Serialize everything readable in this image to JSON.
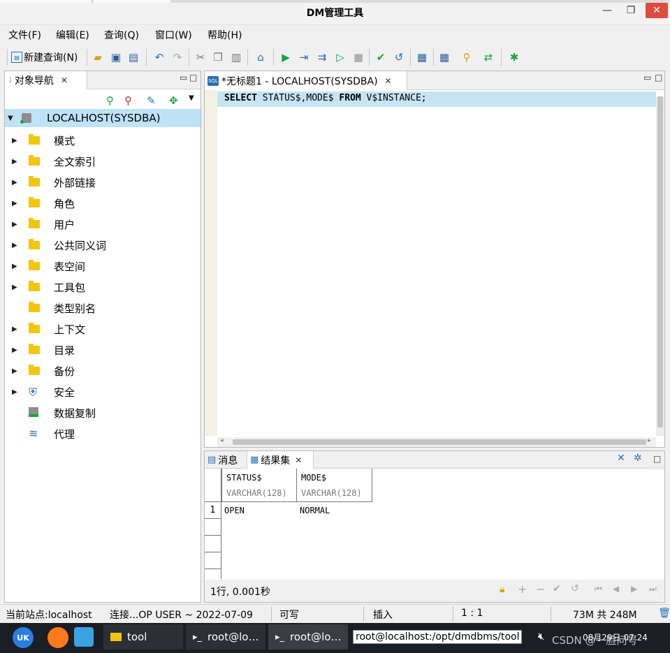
{
  "window": {
    "title": "DM管理工具"
  },
  "menu": [
    "文件(F)",
    "编辑(E)",
    "查询(Q)",
    "窗口(W)",
    "帮助(H)"
  ],
  "toolbar": {
    "new_query": "新建查询(N)"
  },
  "navigator": {
    "tab_label": "对象导航",
    "root": "LOCALHOST(SYSDBA)",
    "items": [
      {
        "label": "模式",
        "expandable": true,
        "icon": "folder-icon"
      },
      {
        "label": "全文索引",
        "expandable": true,
        "icon": "folder-icon"
      },
      {
        "label": "外部链接",
        "expandable": true,
        "icon": "folder-icon"
      },
      {
        "label": "角色",
        "expandable": true,
        "icon": "folder-icon"
      },
      {
        "label": "用户",
        "expandable": true,
        "icon": "folder-icon"
      },
      {
        "label": "公共同义词",
        "expandable": true,
        "icon": "folder-icon"
      },
      {
        "label": "表空间",
        "expandable": true,
        "icon": "folder-icon"
      },
      {
        "label": "工具包",
        "expandable": true,
        "icon": "folder-icon"
      },
      {
        "label": "类型别名",
        "expandable": false,
        "icon": "folder-icon"
      },
      {
        "label": "上下文",
        "expandable": true,
        "icon": "folder-icon"
      },
      {
        "label": "目录",
        "expandable": true,
        "icon": "folder-icon"
      },
      {
        "label": "备份",
        "expandable": true,
        "icon": "folder-icon"
      },
      {
        "label": "安全",
        "expandable": true,
        "icon": "shield-icon"
      },
      {
        "label": "数据复制",
        "expandable": false,
        "icon": "replication-icon"
      },
      {
        "label": "代理",
        "expandable": false,
        "icon": "layers-icon"
      }
    ]
  },
  "editor": {
    "tab_label": "*无标题1 - LOCALHOST(SYSDBA)",
    "code": {
      "kw1": "SELECT",
      "mid": " STATUS$,MODE$ ",
      "kw2": "FROM",
      "rest": " V$INSTANCE;"
    }
  },
  "results": {
    "tab_messages": "消息",
    "tab_resultset": "结果集",
    "columns": [
      {
        "name": "STATUS$",
        "type": "VARCHAR(128)"
      },
      {
        "name": "MODE$",
        "type": "VARCHAR(128)"
      }
    ],
    "rows": [
      {
        "num": "1",
        "cells": [
          "OPEN",
          "NORMAL"
        ]
      }
    ],
    "status": "1行, 0.001秒"
  },
  "statusbar": {
    "site": "当前站点:localhost",
    "connection": "连接...OP USER ~ 2022-07-09",
    "mode": "可写",
    "insert": "插入",
    "position": "1 : 1",
    "memory": "73M 共 248M"
  },
  "taskbar": {
    "items": [
      "tool",
      "root@lo…",
      "root@lo…",
      "root@localhost:/opt/dmdbms/tool"
    ],
    "clock": "08月29日 07:24",
    "watermark": "CSDN @一脸问号"
  },
  "colors": {
    "accent": "#c7e4f4",
    "selection": "#bfe2f7",
    "folder": "#f2c511",
    "run": "#1aa33c"
  }
}
